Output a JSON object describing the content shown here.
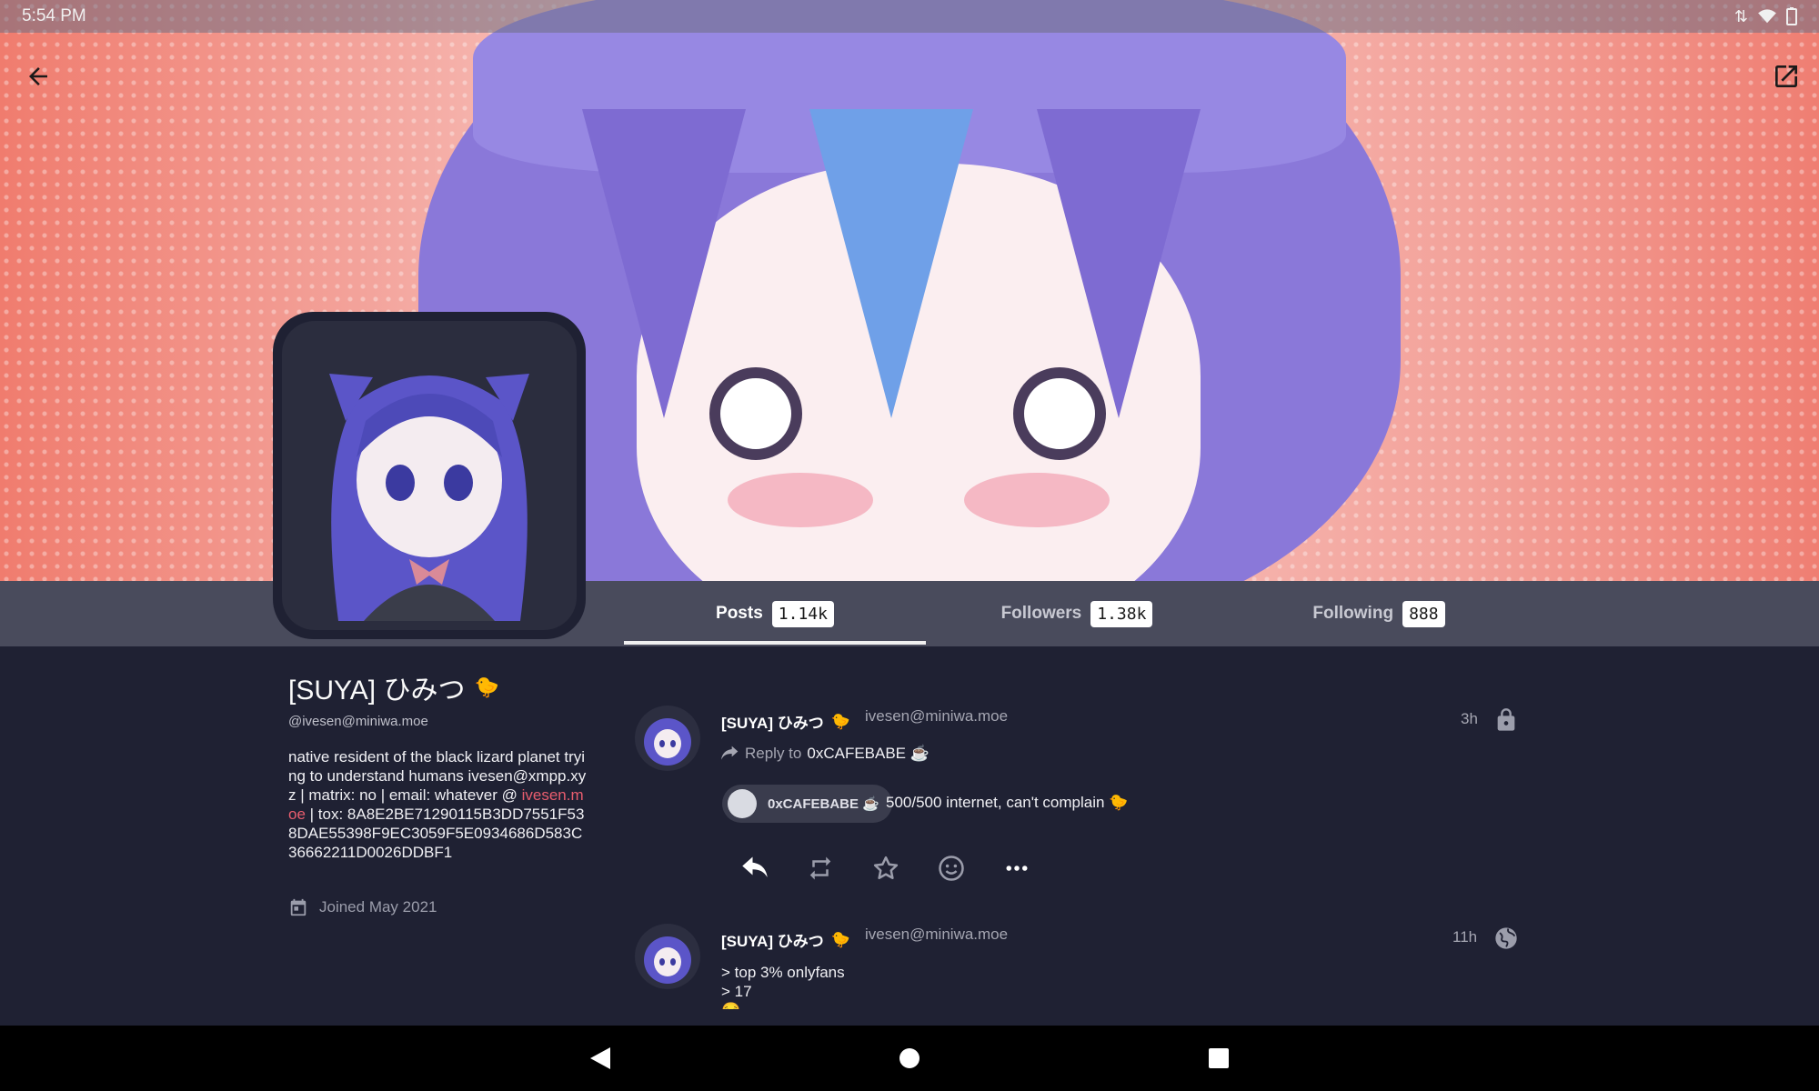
{
  "status_bar": {
    "time": "5:54 PM"
  },
  "header": {
    "back_icon": "arrow-left-icon",
    "open_external_icon": "open-in-new-icon"
  },
  "profile": {
    "display_name": "[SUYA] ひみつ",
    "handle": "@ivesen@miniwa.moe",
    "bio_part1": "native resident of the black lizard planet trying to understand humans ivesen@xmpp.xyz | matrix: no | email: whatever @ ",
    "bio_link": "ivesen.moe",
    "bio_part2": " | tox: 8A8E2BE71290115B3DD7551F538DAE55398F9EC3059F5E0934686D583C36662211D0026DDBF1",
    "joined": "Joined May 2021"
  },
  "tabs": [
    {
      "label": "Posts",
      "count": "1.14k",
      "active": true
    },
    {
      "label": "Followers",
      "count": "1.38k",
      "active": false
    },
    {
      "label": "Following",
      "count": "888",
      "active": false
    }
  ],
  "posts": [
    {
      "author": "[SUYA] ひみつ",
      "acct": "ivesen@miniwa.moe",
      "time": "3h",
      "visibility_icon": "lock-icon",
      "reply_label": "Reply to",
      "reply_target": "0xCAFEBABE ☕",
      "mention_chip": "0xCAFEBABE ☕",
      "text": "500/500 internet, can't complain 🐤"
    },
    {
      "author": "[SUYA] ひみつ",
      "acct": "ivesen@miniwa.moe",
      "time": "11h",
      "visibility_icon": "globe-icon",
      "text_line1": "> top 3% onlyfans",
      "text_line2": "> 17"
    }
  ],
  "navbar": {
    "back": "nav-back-icon",
    "home": "nav-home-icon",
    "recents": "nav-recents-icon"
  }
}
